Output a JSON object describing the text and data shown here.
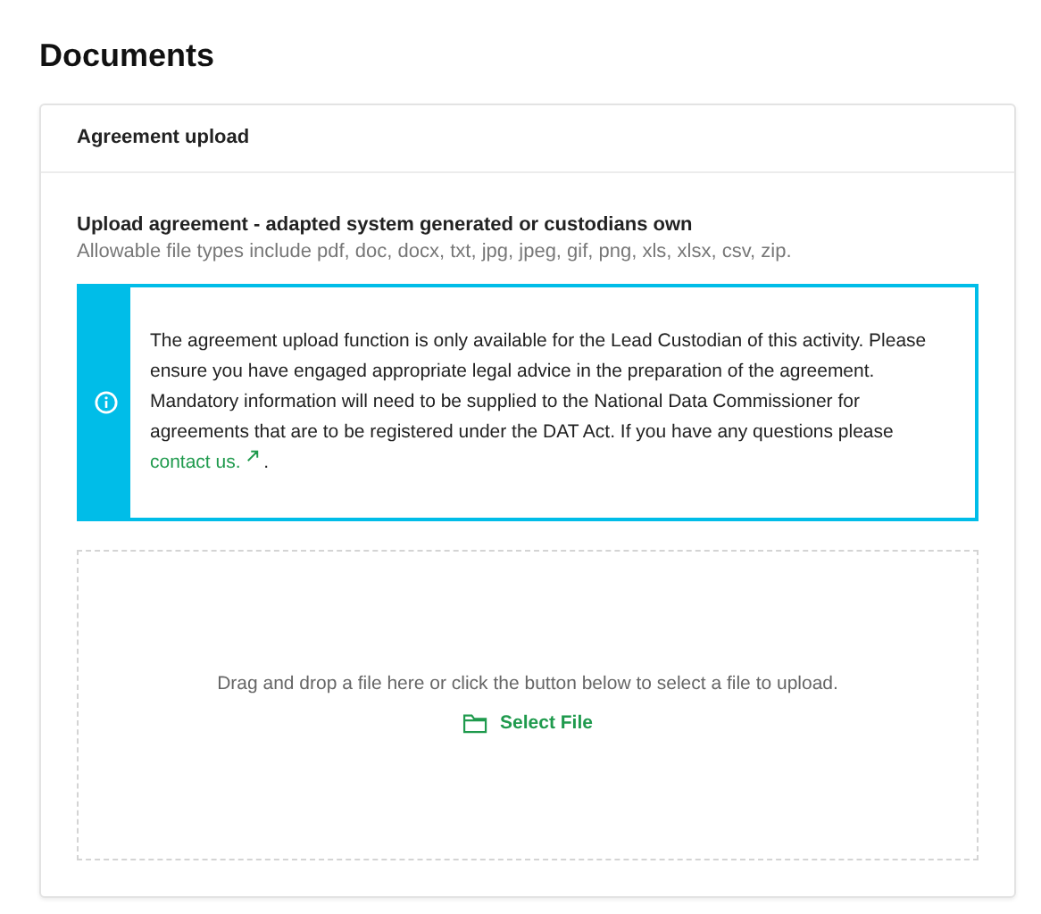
{
  "page_title": "Documents",
  "card": {
    "title": "Agreement upload",
    "section_title": "Upload agreement - adapted system generated or custodians own",
    "section_hint": "Allowable file types include pdf, doc, docx, txt, jpg, jpeg, gif, png, xls, xlsx, csv, zip.",
    "alert": {
      "text": "The agreement upload function is only available for the Lead Custodian of this activity. Please ensure you have engaged appropriate legal advice in the preparation of the agreement. Mandatory information will need to be supplied to the National Data Commissioner for agreements that are to be registered under the DAT Act. If you have any questions please ",
      "link": "contact us.",
      "tail": "."
    },
    "dropzone": {
      "instruction": "Drag and drop a file here or click the button below to select a file to upload.",
      "button": "Select File"
    }
  }
}
